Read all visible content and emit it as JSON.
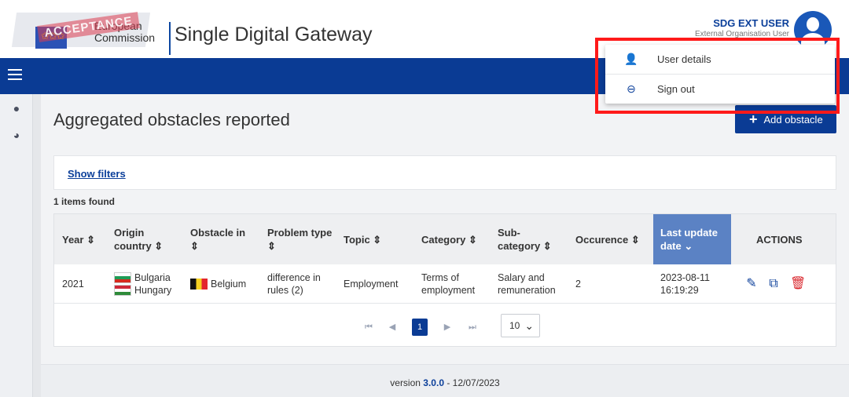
{
  "header": {
    "logo_line1": "European",
    "logo_line2": "Commission",
    "watermark": "ACCEPTANCE",
    "app_title": "Single Digital Gateway",
    "user_name": "SDG EXT USER",
    "user_role": "External Organisation User"
  },
  "user_menu": {
    "items": [
      {
        "label": "User details",
        "icon": "user-icon"
      },
      {
        "label": "Sign out",
        "icon": "sign-out-icon"
      }
    ]
  },
  "rail": {
    "items": [
      {
        "icon": "alert-circle-icon",
        "glyph": "●"
      },
      {
        "icon": "pie-chart-icon",
        "glyph": "◕"
      }
    ]
  },
  "page": {
    "title": "Aggregated obstacles reported",
    "add_button": "Add obstacle",
    "show_filters": "Show filters",
    "items_found": "1 items found"
  },
  "table": {
    "columns": [
      {
        "label": "Year ⇕"
      },
      {
        "label": "Origin country ⇕"
      },
      {
        "label": "Obstacle in ⇕"
      },
      {
        "label": "Problem type ⇕"
      },
      {
        "label": "Topic ⇕"
      },
      {
        "label": "Category ⇕"
      },
      {
        "label": "Sub-category ⇕"
      },
      {
        "label": "Occurence ⇕"
      },
      {
        "label": "Last update date ⌄"
      },
      {
        "label": "ACTIONS"
      }
    ],
    "rows": [
      {
        "year": "2021",
        "origin_1": "Bulgaria",
        "origin_2": "Hungary",
        "obstacle_in": "Belgium",
        "problem_type": "difference in rules (2)",
        "topic": "Employment",
        "category": "Terms of employment",
        "sub_category": "Salary and remuneration",
        "occurence": "2",
        "last_update": "2023-08-11 16:19:29"
      }
    ]
  },
  "pager": {
    "first": "⏮",
    "prev": "◀",
    "current": "1",
    "next": "▶",
    "last": "⏭",
    "page_size": "10"
  },
  "footer": {
    "prefix": "version ",
    "version": "3.0.0",
    "suffix": " - 12/07/2023"
  },
  "colors": {
    "brand_blue": "#0a3b94",
    "sorted_header": "#5b82c4",
    "highlight_red": "#ff1a1a"
  }
}
